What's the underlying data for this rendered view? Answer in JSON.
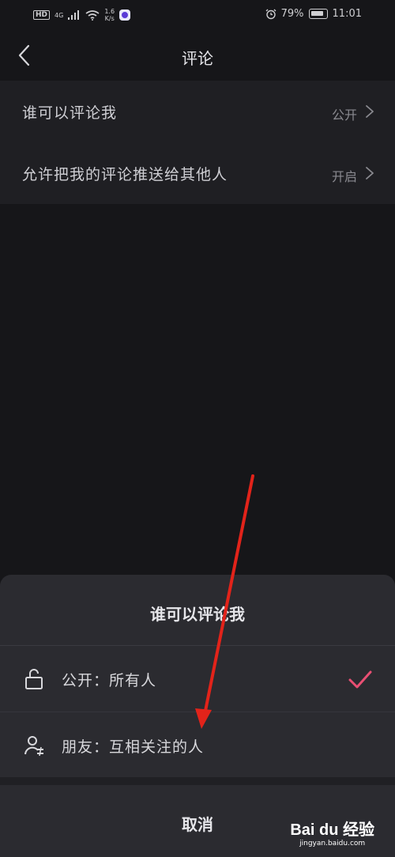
{
  "status_bar": {
    "left_badge": "HD",
    "network": "4G",
    "speed": "1.6\nK/s",
    "battery_percent": "79%",
    "time": "11:01"
  },
  "header": {
    "title": "评论"
  },
  "settings": [
    {
      "label": "谁可以评论我",
      "value": "公开"
    },
    {
      "label": "允许把我的评论推送给其他人",
      "value": "开启"
    }
  ],
  "sheet": {
    "title": "谁可以评论我",
    "options": [
      {
        "label": "公开：所有人",
        "icon": "unlock-icon",
        "selected": true
      },
      {
        "label": "朋友：互相关注的人",
        "icon": "friends-icon",
        "selected": false
      }
    ],
    "cancel_label": "取消"
  },
  "colors": {
    "accent_check": "#e94f73",
    "annotation_arrow": "#e2231a"
  },
  "watermark": {
    "logo": "Bai du 经验",
    "sub": "jingyan.baidu.com"
  }
}
